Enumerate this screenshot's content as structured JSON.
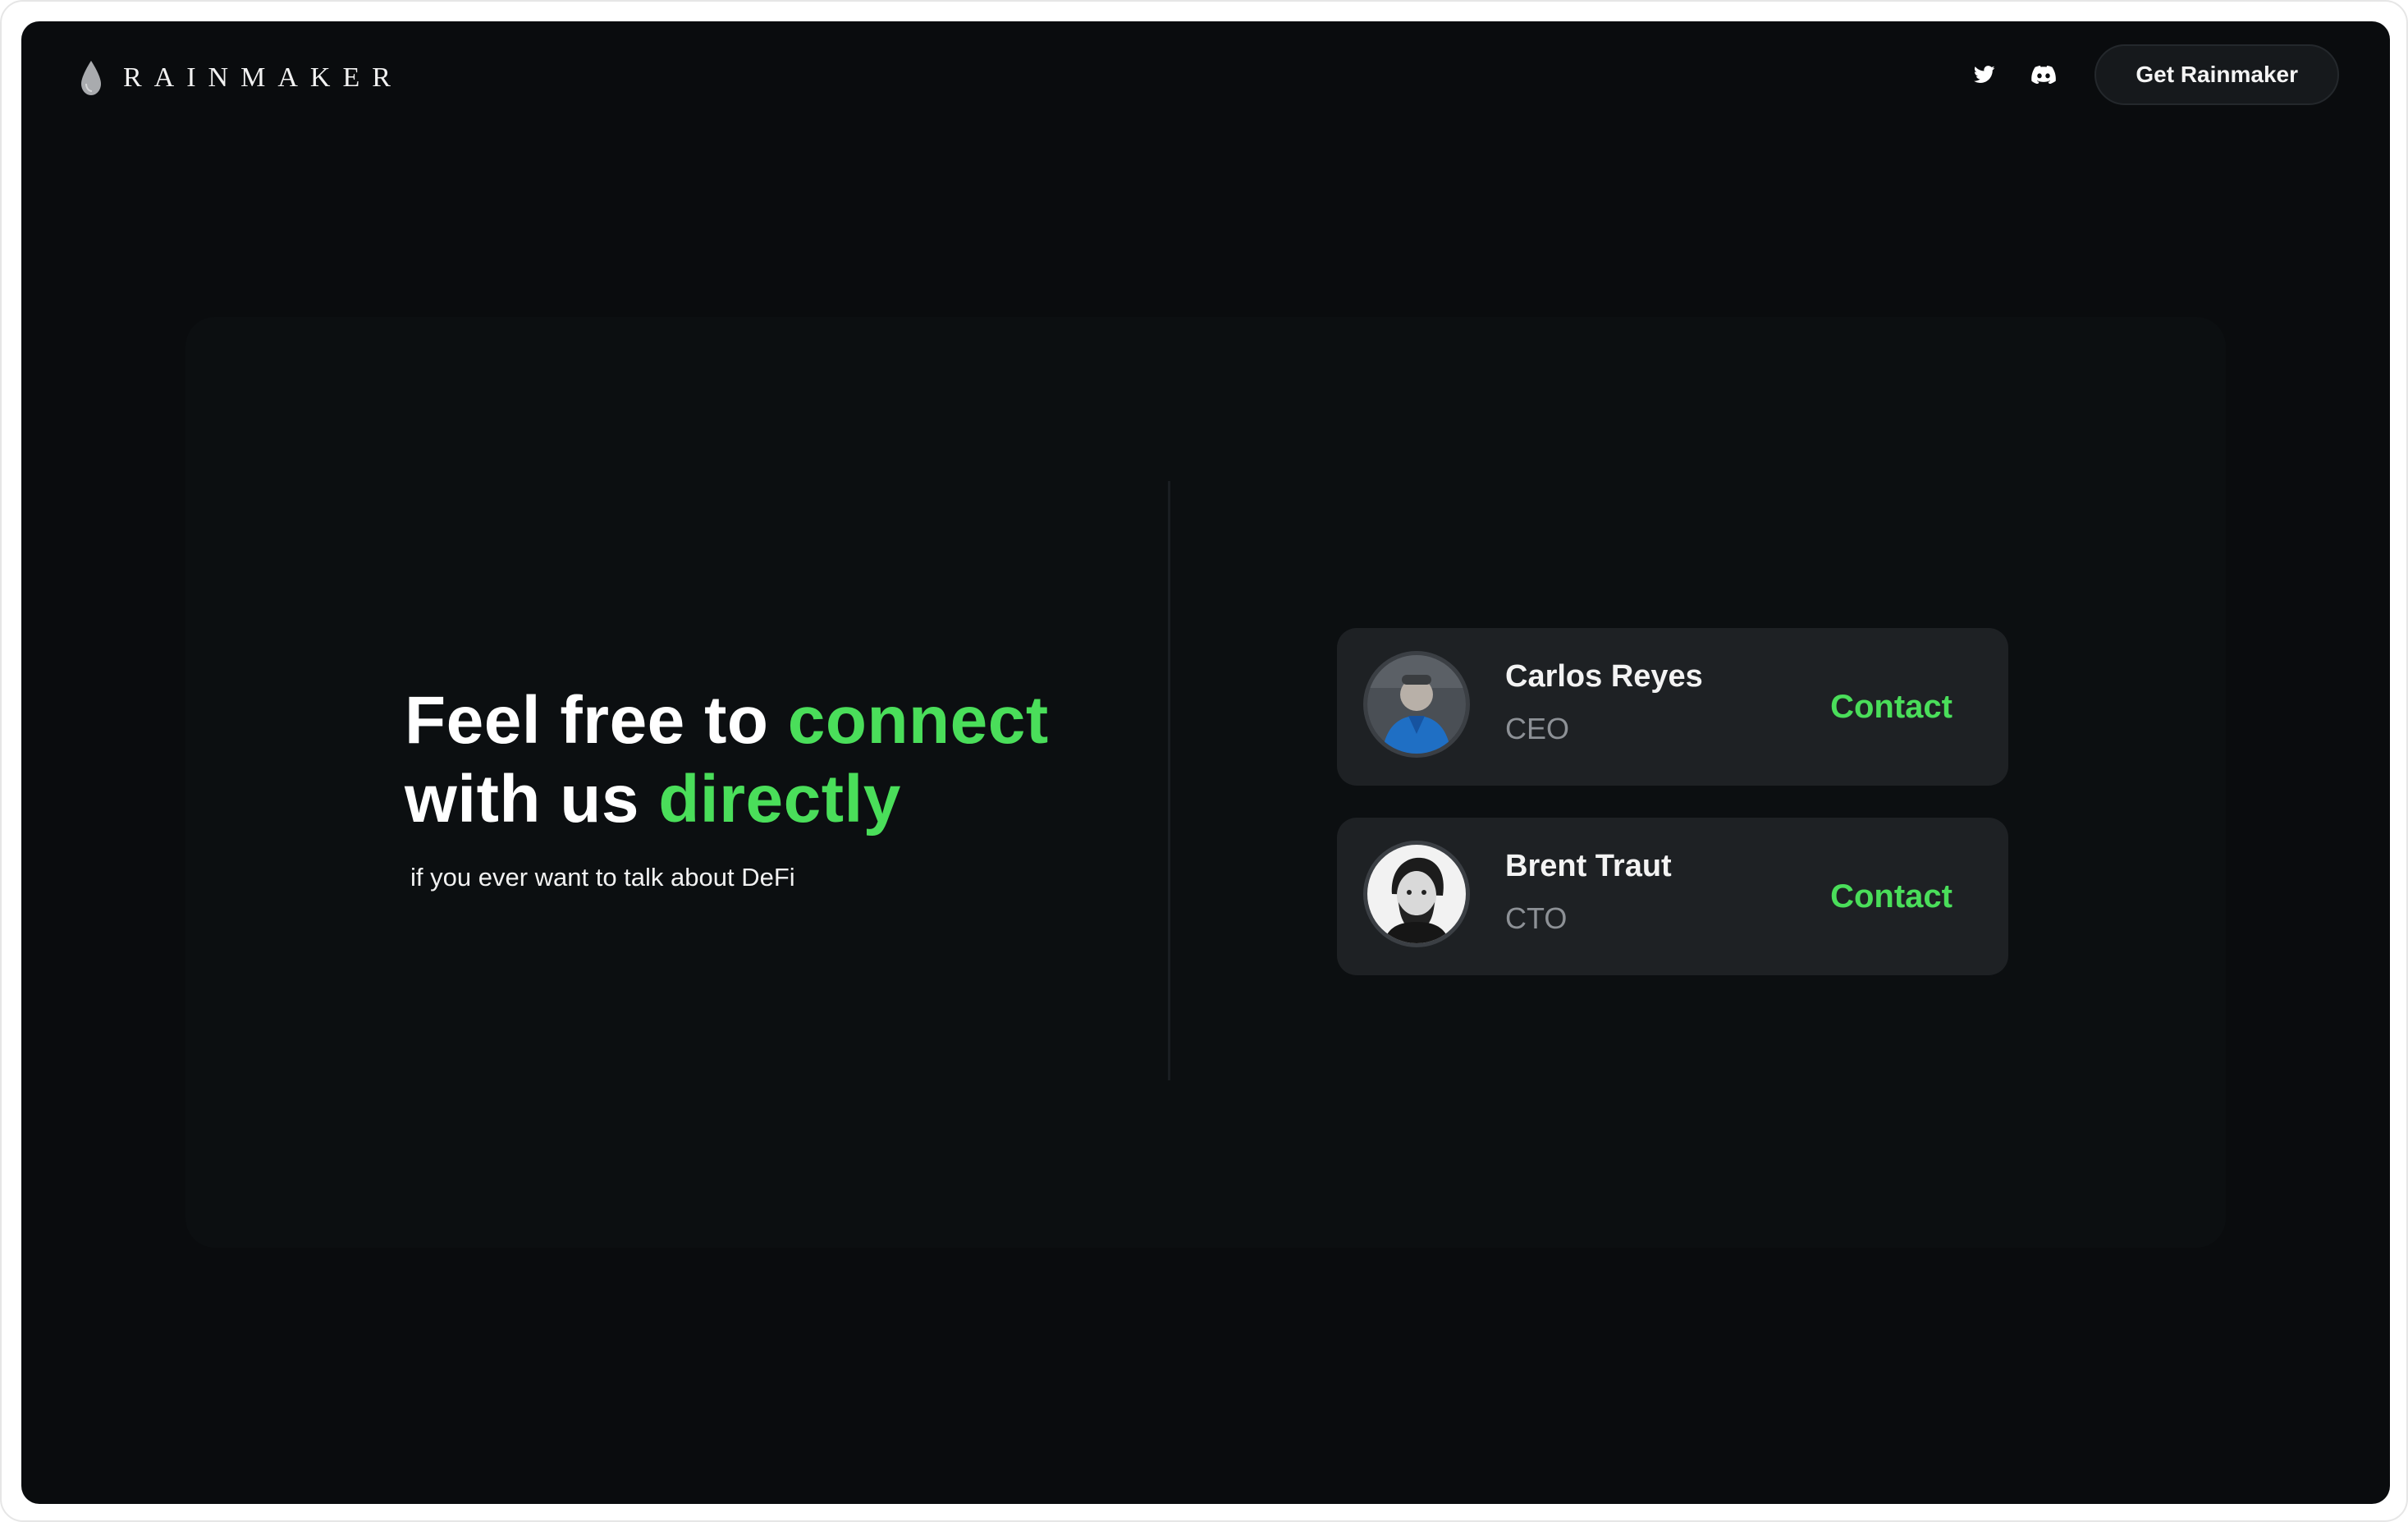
{
  "header": {
    "brand": "RAINMAKER",
    "logo_icon": "raindrop-icon",
    "social_icons": [
      "twitter-icon",
      "discord-icon"
    ],
    "cta_label": "Get Rainmaker"
  },
  "hero": {
    "headline_part1": "Feel free to ",
    "headline_highlight1": "connect",
    "headline_part2": "with us ",
    "headline_highlight2": "directly",
    "subtext": "if you ever want to talk about DeFi"
  },
  "team": [
    {
      "name": "Carlos Reyes",
      "role": "CEO",
      "contact_label": "Contact"
    },
    {
      "name": "Brent Traut",
      "role": "CTO",
      "contact_label": "Contact"
    }
  ],
  "colors": {
    "background": "#0a0c0e",
    "panel": "#0c0f11",
    "card": "#1e2124",
    "accent_green": "#4ade5a",
    "muted_text": "#8d9196"
  }
}
